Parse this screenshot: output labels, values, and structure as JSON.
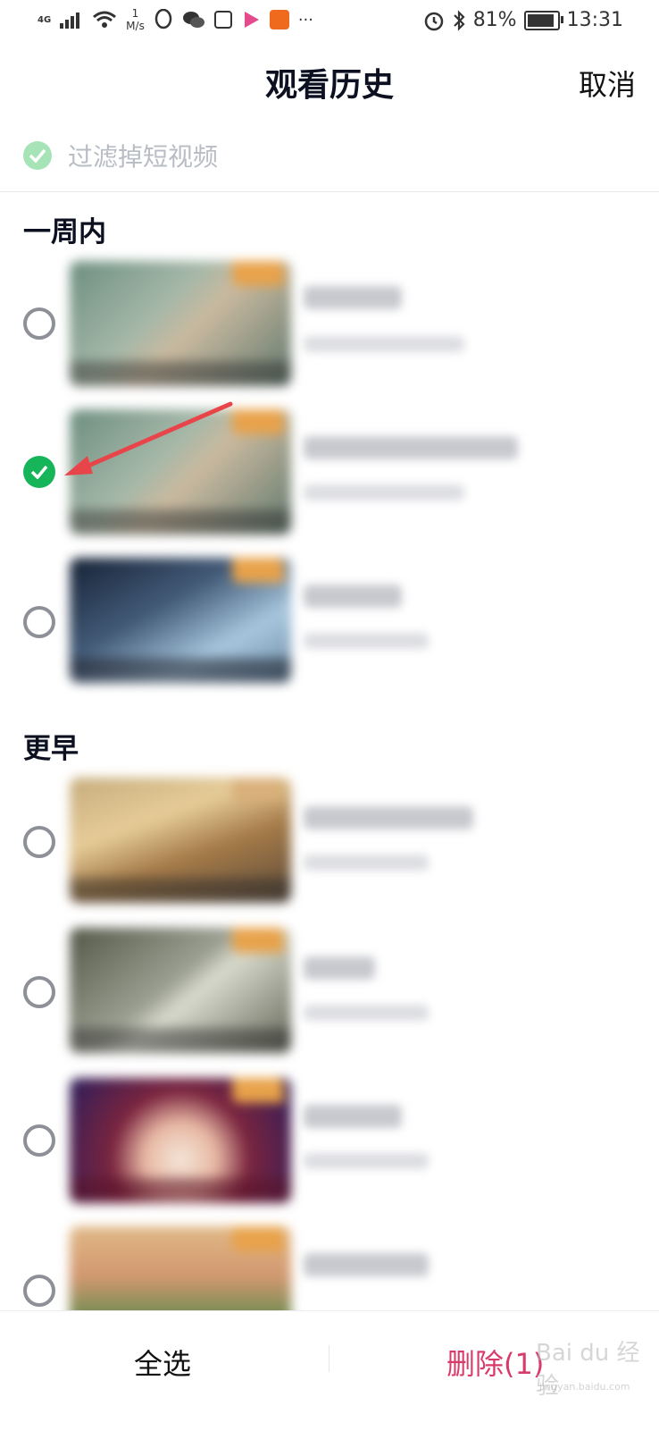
{
  "status_bar": {
    "network": "4G",
    "speed_value": "1",
    "speed_unit": "M/s",
    "battery_percent": "81%",
    "battery_level": 0.81,
    "time": "13:31",
    "more": "···",
    "icons": [
      "signal-icon",
      "wifi-icon",
      "qq-icon",
      "wechat-icon",
      "news-app-icon",
      "video-app-icon",
      "kuaishou-icon",
      "alarm-icon",
      "bluetooth-icon",
      "battery-icon"
    ]
  },
  "header": {
    "title": "观看历史",
    "cancel_label": "取消"
  },
  "filter": {
    "label": "过滤掉短视频",
    "checked": true
  },
  "sections": [
    {
      "title": "一周内"
    },
    {
      "title": "更早"
    }
  ],
  "items": [
    {
      "checked": false
    },
    {
      "checked": true
    },
    {
      "checked": false
    },
    {
      "checked": false
    },
    {
      "checked": false
    },
    {
      "checked": false
    },
    {
      "checked": false
    }
  ],
  "colors": {
    "accent_green": "#17b55a",
    "delete_red": "#d83a6a",
    "annotation_arrow": "#e8454a"
  },
  "bottom_bar": {
    "select_all_label": "全选",
    "delete_label": "删除(1)"
  },
  "watermark": {
    "text": "Bai du 经验",
    "sub": "jingyan.baidu.com"
  }
}
